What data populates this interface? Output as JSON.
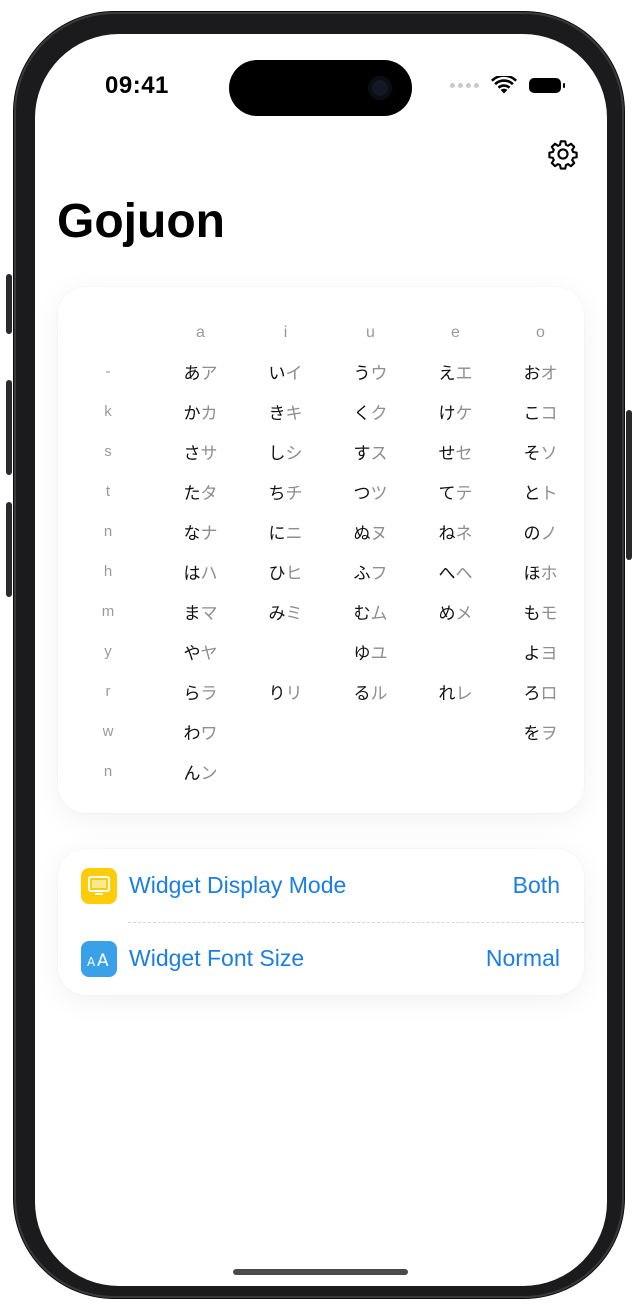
{
  "status": {
    "time": "09:41"
  },
  "header": {
    "title": "Gojuon"
  },
  "gojuon": {
    "columns": [
      "a",
      "i",
      "u",
      "e",
      "o"
    ],
    "rows": [
      {
        "label": "-",
        "cells": [
          [
            "あ",
            "ア"
          ],
          [
            "い",
            "イ"
          ],
          [
            "う",
            "ウ"
          ],
          [
            "え",
            "エ"
          ],
          [
            "お",
            "オ"
          ]
        ]
      },
      {
        "label": "k",
        "cells": [
          [
            "か",
            "カ"
          ],
          [
            "き",
            "キ"
          ],
          [
            "く",
            "ク"
          ],
          [
            "け",
            "ケ"
          ],
          [
            "こ",
            "コ"
          ]
        ]
      },
      {
        "label": "s",
        "cells": [
          [
            "さ",
            "サ"
          ],
          [
            "し",
            "シ"
          ],
          [
            "す",
            "ス"
          ],
          [
            "せ",
            "セ"
          ],
          [
            "そ",
            "ソ"
          ]
        ]
      },
      {
        "label": "t",
        "cells": [
          [
            "た",
            "タ"
          ],
          [
            "ち",
            "チ"
          ],
          [
            "つ",
            "ツ"
          ],
          [
            "て",
            "テ"
          ],
          [
            "と",
            "ト"
          ]
        ]
      },
      {
        "label": "n",
        "cells": [
          [
            "な",
            "ナ"
          ],
          [
            "に",
            "ニ"
          ],
          [
            "ぬ",
            "ヌ"
          ],
          [
            "ね",
            "ネ"
          ],
          [
            "の",
            "ノ"
          ]
        ]
      },
      {
        "label": "h",
        "cells": [
          [
            "は",
            "ハ"
          ],
          [
            "ひ",
            "ヒ"
          ],
          [
            "ふ",
            "フ"
          ],
          [
            "へ",
            "ヘ"
          ],
          [
            "ほ",
            "ホ"
          ]
        ]
      },
      {
        "label": "m",
        "cells": [
          [
            "ま",
            "マ"
          ],
          [
            "み",
            "ミ"
          ],
          [
            "む",
            "ム"
          ],
          [
            "め",
            "メ"
          ],
          [
            "も",
            "モ"
          ]
        ]
      },
      {
        "label": "y",
        "cells": [
          [
            "や",
            "ヤ"
          ],
          null,
          [
            "ゆ",
            "ユ"
          ],
          null,
          [
            "よ",
            "ヨ"
          ]
        ]
      },
      {
        "label": "r",
        "cells": [
          [
            "ら",
            "ラ"
          ],
          [
            "り",
            "リ"
          ],
          [
            "る",
            "ル"
          ],
          [
            "れ",
            "レ"
          ],
          [
            "ろ",
            "ロ"
          ]
        ]
      },
      {
        "label": "w",
        "cells": [
          [
            "わ",
            "ワ"
          ],
          null,
          null,
          null,
          [
            "を",
            "ヲ"
          ]
        ]
      },
      {
        "label": "n",
        "cells": [
          [
            "ん",
            "ン"
          ],
          null,
          null,
          null,
          null
        ]
      }
    ]
  },
  "settings": {
    "display_mode": {
      "label": "Widget Display Mode",
      "value": "Both",
      "icon": "display-icon",
      "icon_color": "#FFCC0A"
    },
    "font_size": {
      "label": "Widget Font Size",
      "value": "Normal",
      "icon": "font-size-icon",
      "icon_color": "#3AA0E8"
    }
  },
  "colors": {
    "accent": "#1A7EE6"
  }
}
